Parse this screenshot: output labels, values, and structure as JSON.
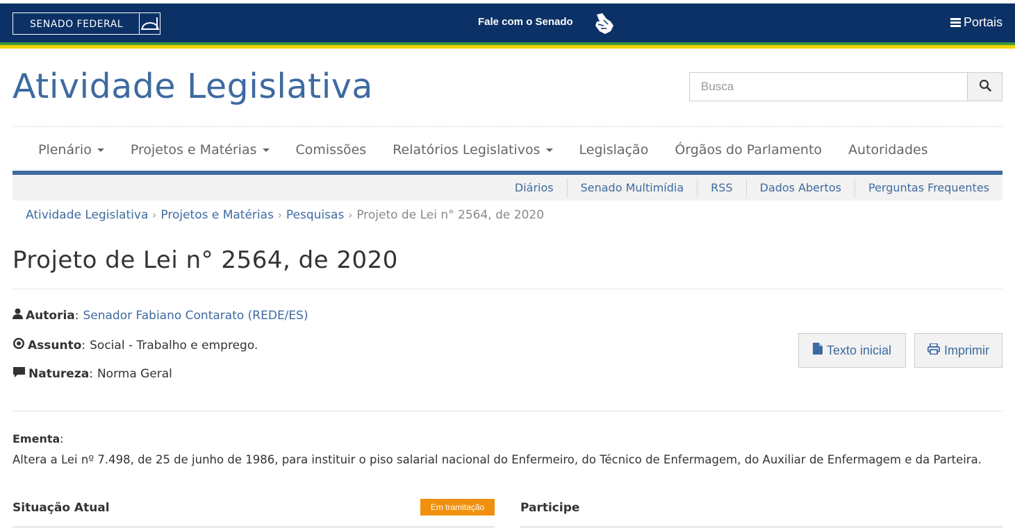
{
  "topbar": {
    "logo_text": "SENADO FEDERAL",
    "fale_label": "Fale com o Senado",
    "libras_icon": "sign-language-hands-icon",
    "portais_label": "Portais"
  },
  "header": {
    "site_title": "Atividade Legislativa",
    "search_placeholder": "Busca",
    "search_icon": "search-icon"
  },
  "main_nav": [
    {
      "label": "Plenário",
      "has_dropdown": true
    },
    {
      "label": "Projetos e Matérias",
      "has_dropdown": true
    },
    {
      "label": "Comissões",
      "has_dropdown": false
    },
    {
      "label": "Relatórios Legislativos",
      "has_dropdown": true
    },
    {
      "label": "Legislação",
      "has_dropdown": false
    },
    {
      "label": "Órgãos do Parlamento",
      "has_dropdown": false
    },
    {
      "label": "Autoridades",
      "has_dropdown": false
    }
  ],
  "sub_nav": [
    "Diários",
    "Senado Multimídia",
    "RSS",
    "Dados Abertos",
    "Perguntas Frequentes"
  ],
  "breadcrumb": {
    "items": [
      "Atividade Legislativa",
      "Projetos e Matérias",
      "Pesquisas"
    ],
    "separator": "›",
    "current": "Projeto de Lei n° 2564, de 2020"
  },
  "page_title": "Projeto de Lei n° 2564, de 2020",
  "info": {
    "autoria": {
      "label": "Autoria",
      "value": "Senador Fabiano Contarato (REDE/ES)",
      "icon": "user-icon"
    },
    "assunto": {
      "label": "Assunto",
      "value": "Social - Trabalho e emprego.",
      "icon": "dot-circle-icon"
    },
    "natureza": {
      "label": "Natureza",
      "value": "Norma Geral",
      "icon": "comment-icon"
    }
  },
  "actions": {
    "texto_inicial": "Texto inicial",
    "imprimir": "Imprimir"
  },
  "ementa": {
    "label": "Ementa",
    "text": "Altera a Lei nº 7.498, de 25 de junho de 1986, para instituir o piso salarial nacional do Enfermeiro, do Técnico de Enfermagem, do Auxiliar de Enfermagem e da Parteira."
  },
  "situacao": {
    "title": "Situação Atual",
    "badge": "Em tramitação"
  },
  "participe": {
    "title": "Participe"
  },
  "colors": {
    "top_bar": "#0c3166",
    "brand_blue": "#3d6aa0",
    "stripe_green": "#3f9a3a",
    "stripe_yellow": "#f3d100",
    "badge_orange": "#f0900e"
  }
}
